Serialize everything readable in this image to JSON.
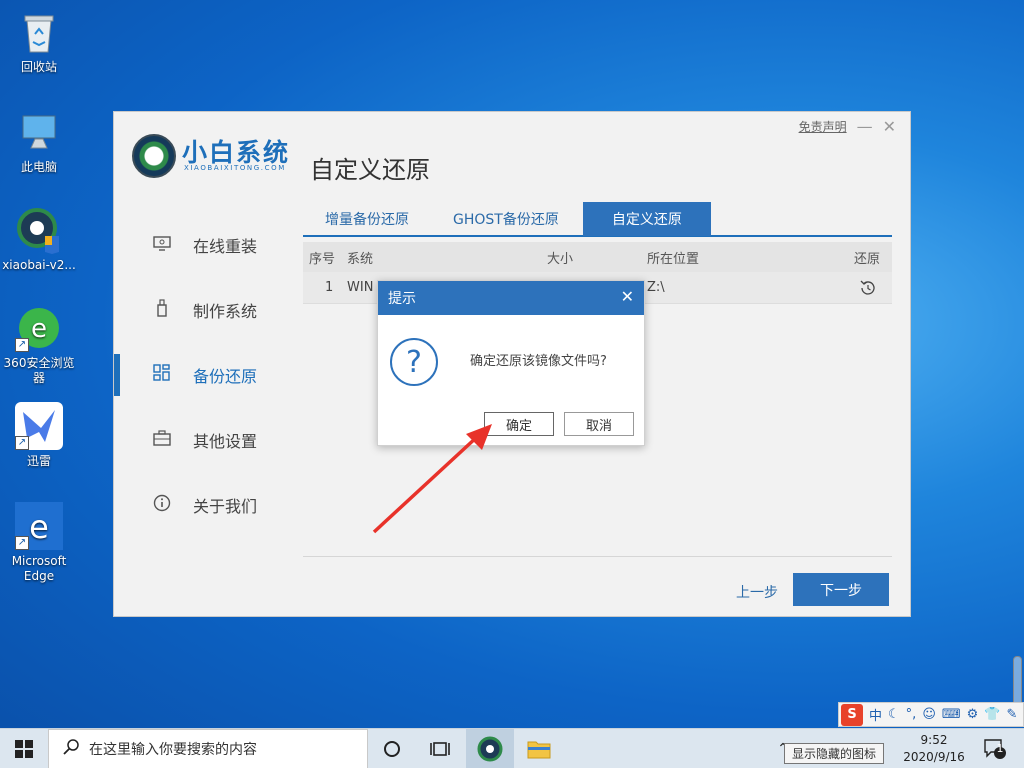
{
  "desktop": {
    "icons": [
      {
        "label": "回收站",
        "icon": "recycle-bin-icon"
      },
      {
        "label": "此电脑",
        "icon": "computer-icon"
      },
      {
        "label": "xiaobai-v2...",
        "icon": "xiaobai-icon"
      },
      {
        "label": "360安全浏览器",
        "icon": "browser-360-icon"
      },
      {
        "label": "迅雷",
        "icon": "xunlei-icon"
      },
      {
        "label": "Microsoft Edge",
        "icon": "edge-icon"
      }
    ]
  },
  "window": {
    "brand": "小白系统",
    "brand_sub": "XIAOBAIXITONG.COM",
    "page_title": "自定义还原",
    "disclaimer": "免责声明",
    "minimize": "—",
    "close": "✕",
    "nav": [
      {
        "label": "在线重装",
        "icon": "monitor-icon"
      },
      {
        "label": "制作系统",
        "icon": "usb-icon"
      },
      {
        "label": "备份还原",
        "icon": "grid-icon",
        "active": true
      },
      {
        "label": "其他设置",
        "icon": "briefcase-icon"
      },
      {
        "label": "关于我们",
        "icon": "info-icon"
      }
    ],
    "tabs": [
      {
        "label": "增量备份还原"
      },
      {
        "label": "GHOST备份还原"
      },
      {
        "label": "自定义还原",
        "active": true
      }
    ],
    "table": {
      "headers": {
        "seq": "序号",
        "system": "系统",
        "size": "大小",
        "location": "所在位置",
        "restore": "还原"
      },
      "rows": [
        {
          "seq": "1",
          "system": "WIN",
          "size": "",
          "location": "Z:\\",
          "restore_icon": "restore-icon"
        }
      ]
    },
    "prev_label": "上一步",
    "next_label": "下一步"
  },
  "dialog": {
    "title": "提示",
    "close": "✕",
    "question_mark": "?",
    "message": "确定还原该镜像文件吗?",
    "ok": "确定",
    "cancel": "取消"
  },
  "taskbar": {
    "search_placeholder": "在这里输入你要搜索的内容",
    "time": "9:52",
    "date": "2020/9/16",
    "tooltip": "显示隐藏的图标",
    "notification_count": "1",
    "ime_lang": "中"
  },
  "colors": {
    "accent": "#2d72bb",
    "arrow": "#e8322a"
  }
}
